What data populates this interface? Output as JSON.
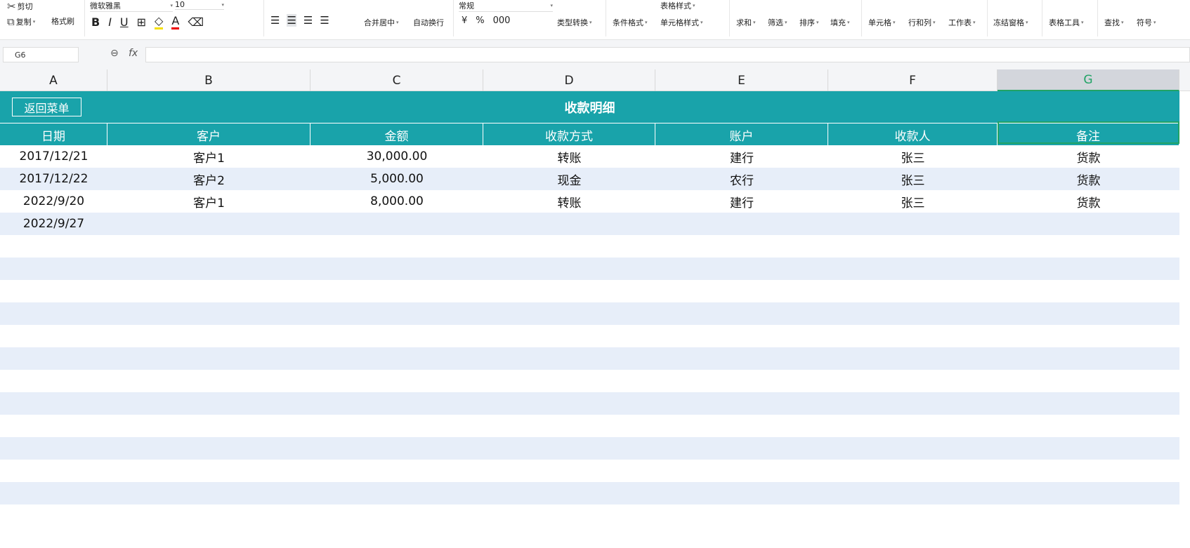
{
  "ribbon": {
    "cut": "剪切",
    "copy": "复制",
    "format_painter": "格式刷",
    "font": "微软雅黑",
    "font_size": "10",
    "merge_center": "合并居中",
    "wrap": "自动换行",
    "number_format": "常规",
    "type_convert": "类型转换",
    "cond_format": "条件格式",
    "table_style": "表格样式",
    "cell_style": "单元格样式",
    "sum": "求和",
    "filter": "筛选",
    "sort": "排序",
    "fill": "填充",
    "cell": "单元格",
    "rowcol": "行和列",
    "sheet": "工作表",
    "freeze": "冻结窗格",
    "table_tools": "表格工具",
    "find": "查找",
    "symbol": "符号"
  },
  "formula_bar": {
    "name_box": "G6",
    "fx": "fx",
    "value": ""
  },
  "columns": [
    "A",
    "B",
    "C",
    "D",
    "E",
    "F",
    "G"
  ],
  "sheet": {
    "back_button": "返回菜单",
    "title": "收款明细",
    "headers": [
      "日期",
      "客户",
      "金额",
      "收款方式",
      "账户",
      "收款人",
      "备注"
    ],
    "rows": [
      [
        "2017/12/21",
        "客户1",
        "30,000.00",
        "转账",
        "建行",
        "张三",
        "货款"
      ],
      [
        "2017/12/22",
        "客户2",
        "5,000.00",
        "现金",
        "农行",
        "张三",
        "货款"
      ],
      [
        "2022/9/20",
        "客户1",
        "8,000.00",
        "转账",
        "建行",
        "张三",
        "货款"
      ],
      [
        "2022/9/27",
        "",
        "",
        "",
        "",
        "",
        ""
      ]
    ]
  }
}
